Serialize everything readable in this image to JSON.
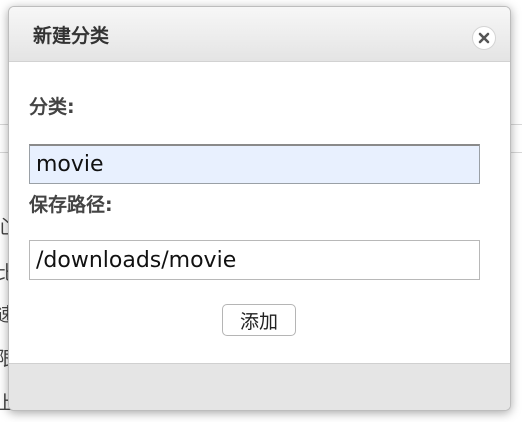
{
  "dialog": {
    "title": "新建分类",
    "close_icon": "close-icon",
    "fields": {
      "category_label": "分类:",
      "category_value": "movie",
      "path_label": "保存路径:",
      "path_value": "/downloads/movie"
    },
    "add_button_label": "添加"
  },
  "background": {
    "glyphs": [
      "心",
      "比",
      "速",
      "限",
      "上"
    ]
  },
  "colors": {
    "autofill_bg": "#e8f0fe",
    "titlebar": "#ececec",
    "footer": "#e5e5e5"
  }
}
